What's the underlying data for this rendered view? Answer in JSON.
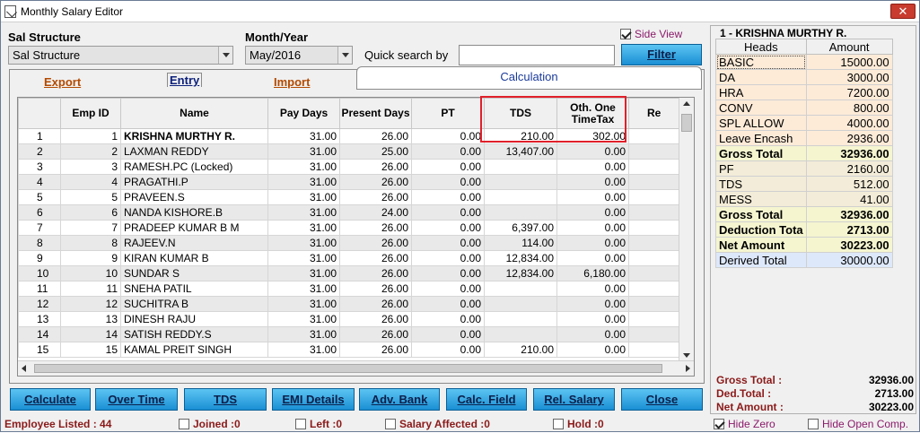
{
  "window": {
    "title": "Monthly Salary Editor",
    "close_icon": "close-icon"
  },
  "filters": {
    "sal_structure_label": "Sal Structure",
    "sal_structure_value": "Sal Structure",
    "month_year_label": "Month/Year",
    "month_year_value": "May/2016",
    "quick_search_label": "Quick search by",
    "quick_search_value": "",
    "filter_button": "Filter",
    "side_view_label": "Side View",
    "side_view_checked": true
  },
  "tabs": {
    "export": "Export",
    "entry": "Entry",
    "import": "Import",
    "calculation": "Calculation"
  },
  "grid": {
    "columns": [
      "",
      "Emp ID",
      "Name",
      "Pay Days",
      "Present Days",
      "PT",
      "TDS",
      "Oth. One TimeTax",
      "Re"
    ],
    "rows": [
      [
        "1",
        "1",
        "KRISHNA MURTHY R.",
        "31.00",
        "26.00",
        "0.00",
        "210.00",
        "302.00"
      ],
      [
        "2",
        "2",
        "LAXMAN REDDY",
        "31.00",
        "25.00",
        "0.00",
        "13,407.00",
        "0.00"
      ],
      [
        "3",
        "3",
        "RAMESH.PC (Locked)",
        "31.00",
        "26.00",
        "0.00",
        "",
        "0.00"
      ],
      [
        "4",
        "4",
        "PRAGATHI.P",
        "31.00",
        "26.00",
        "0.00",
        "",
        "0.00"
      ],
      [
        "5",
        "5",
        "PRAVEEN.S",
        "31.00",
        "26.00",
        "0.00",
        "",
        "0.00"
      ],
      [
        "6",
        "6",
        "NANDA KISHORE.B",
        "31.00",
        "24.00",
        "0.00",
        "",
        "0.00"
      ],
      [
        "7",
        "7",
        "PRADEEP KUMAR B M",
        "31.00",
        "26.00",
        "0.00",
        "6,397.00",
        "0.00"
      ],
      [
        "8",
        "8",
        "RAJEEV.N",
        "31.00",
        "26.00",
        "0.00",
        "114.00",
        "0.00"
      ],
      [
        "9",
        "9",
        "KIRAN KUMAR B",
        "31.00",
        "26.00",
        "0.00",
        "12,834.00",
        "0.00"
      ],
      [
        "10",
        "10",
        "SUNDAR S",
        "31.00",
        "26.00",
        "0.00",
        "12,834.00",
        "6,180.00"
      ],
      [
        "11",
        "11",
        "SNEHA PATIL",
        "31.00",
        "26.00",
        "0.00",
        "",
        "0.00"
      ],
      [
        "12",
        "12",
        "SUCHITRA B",
        "31.00",
        "26.00",
        "0.00",
        "",
        "0.00"
      ],
      [
        "13",
        "13",
        "DINESH RAJU",
        "31.00",
        "26.00",
        "0.00",
        "",
        "0.00"
      ],
      [
        "14",
        "14",
        "SATISH REDDY.S",
        "31.00",
        "26.00",
        "0.00",
        "",
        "0.00"
      ],
      [
        "15",
        "15",
        "KAMAL PREIT SINGH",
        "31.00",
        "26.00",
        "0.00",
        "210.00",
        "0.00"
      ]
    ]
  },
  "buttons": {
    "calculate": "Calculate",
    "over_time": "Over Time",
    "tds": "TDS",
    "emi_details": "EMI Details",
    "adv_bank": "Adv. Bank",
    "calc_field": "Calc. Field",
    "rel_salary": "Rel. Salary",
    "close": "Close"
  },
  "status": {
    "employee_listed": "Employee Listed : 44",
    "joined": "Joined :0",
    "left": "Left :0",
    "salary_affected": "Salary Affected :0",
    "hold": "Hold :0",
    "hide_zero": "Hide Zero",
    "hide_zero_checked": true,
    "hide_open_comp": "Hide Open Comp."
  },
  "side_panel": {
    "employee_title": "1 - KRISHNA MURTHY R.",
    "col_heads": "Heads",
    "col_amount": "Amount",
    "rows": [
      {
        "head": "BASIC",
        "amount": "15000.00",
        "kind": "earn"
      },
      {
        "head": "DA",
        "amount": "3000.00",
        "kind": "earn"
      },
      {
        "head": "HRA",
        "amount": "7200.00",
        "kind": "earn"
      },
      {
        "head": "CONV",
        "amount": "800.00",
        "kind": "earn"
      },
      {
        "head": "SPL ALLOW",
        "amount": "4000.00",
        "kind": "earn"
      },
      {
        "head": "Leave Encash",
        "amount": "2936.00",
        "kind": "earn"
      },
      {
        "head": "Gross Total",
        "amount": "32936.00",
        "kind": "gross"
      },
      {
        "head": "PF",
        "amount": "2160.00",
        "kind": "ded"
      },
      {
        "head": "TDS",
        "amount": "512.00",
        "kind": "ded"
      },
      {
        "head": "MESS",
        "amount": "41.00",
        "kind": "ded"
      },
      {
        "head": "Gross Total",
        "amount": "32936.00",
        "kind": "gross"
      },
      {
        "head": "Deduction Tota",
        "amount": "2713.00",
        "kind": "total"
      },
      {
        "head": "Net Amount",
        "amount": "30223.00",
        "kind": "total"
      },
      {
        "head": "Derived Total",
        "amount": "30000.00",
        "kind": "derived"
      }
    ],
    "gross_total_label": "Gross Total  :",
    "gross_total_value": "32936.00",
    "ded_total_label": "Ded.Total     :",
    "ded_total_value": "2713.00",
    "net_amount_label": "Net Amount :",
    "net_amount_value": "30223.00"
  }
}
